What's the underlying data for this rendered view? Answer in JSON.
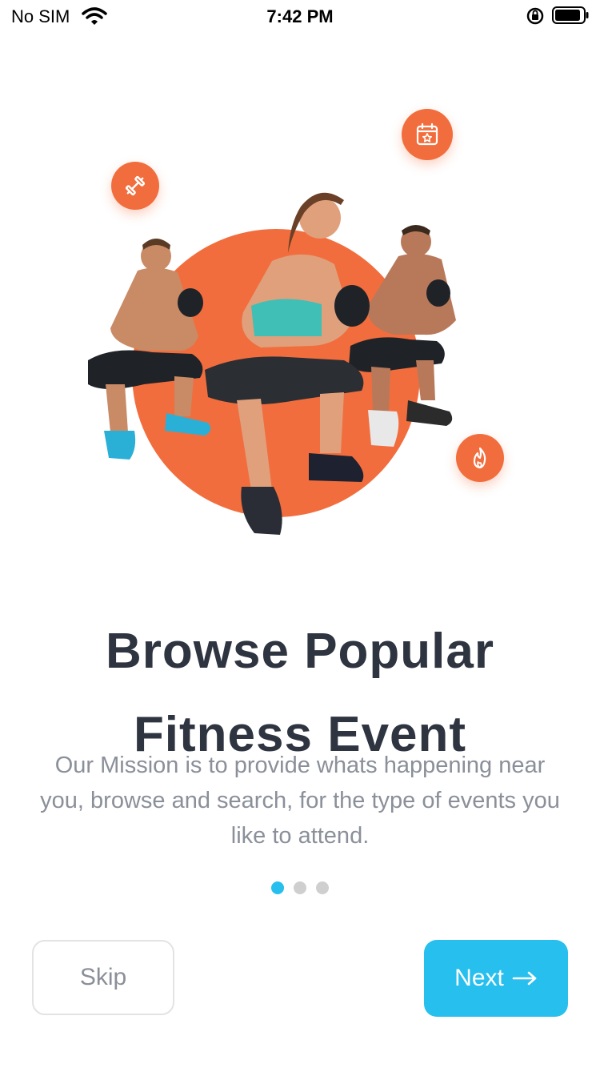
{
  "status_bar": {
    "carrier": "No SIM",
    "time": "7:42 PM"
  },
  "onboarding": {
    "title_line1": "Browse Popular",
    "title_line2": "Fitness Event",
    "description": "Our Mission is to provide whats happening near you, browse and search, for the type of events you like to attend.",
    "page_count": 3,
    "current_page": 1
  },
  "actions": {
    "skip_label": "Skip",
    "next_label": "Next"
  },
  "icons": {
    "badges": [
      "dumbbell-icon",
      "calendar-star-icon",
      "flame-icon"
    ],
    "next": "arrow-right-icon"
  },
  "colors": {
    "accent": "#26bfee",
    "hero_circle": "#f26d3d",
    "title": "#2f3441",
    "body_text": "#8a8f99"
  }
}
